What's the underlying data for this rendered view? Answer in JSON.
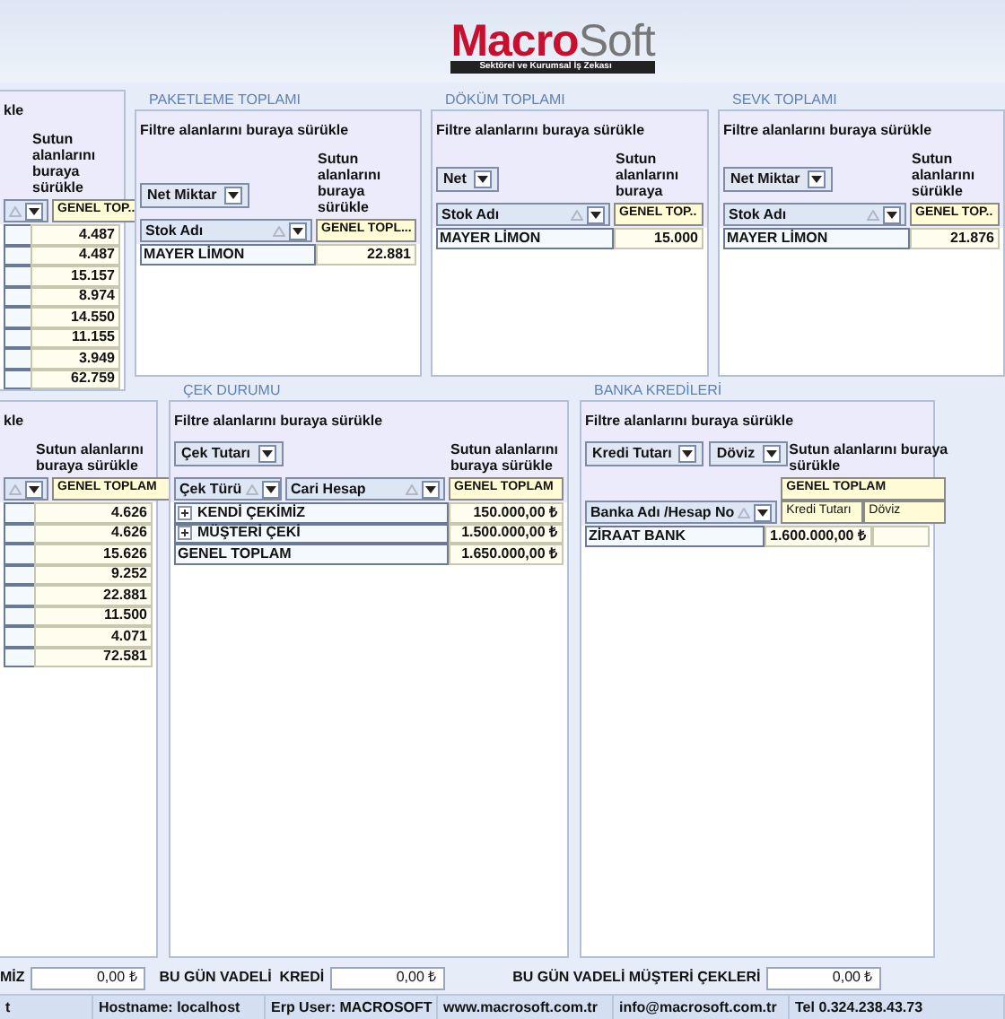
{
  "header": {
    "logo_primary": "Macro",
    "logo_secondary": "Soft",
    "tagline": "Sektörel ve Kurumsal İş Zekası"
  },
  "top_panels": [
    {
      "kind": "partial",
      "filter_hint": "kle",
      "column_hint": "Sutun alanlarını buraya sürükle",
      "column_header": "GENEL TOP..",
      "rows": [
        {
          "values": [
            "4.487"
          ]
        },
        {
          "values": [
            "4.487"
          ]
        },
        {
          "values": [
            "15.157"
          ]
        },
        {
          "values": [
            "8.974"
          ]
        },
        {
          "values": [
            "14.550"
          ]
        },
        {
          "values": [
            "11.155"
          ]
        },
        {
          "values": [
            "3.949"
          ]
        },
        {
          "values": [
            "62.759"
          ]
        }
      ]
    },
    {
      "kind": "full",
      "title": "PAKETLEME TOPLAMI",
      "filter_hint": "Filtre alanlarını buraya sürükle",
      "data_fields": [
        "Net Miktar"
      ],
      "column_hint": "Sutun alanlarını buraya sürükle",
      "row_headers": [
        "Stok Adı"
      ],
      "column_header": "GENEL TOPL...",
      "rows": [
        {
          "label": "MAYER LİMON",
          "values": [
            "22.881"
          ]
        }
      ]
    },
    {
      "kind": "full",
      "title": "DÖKÜM TOPLAMI",
      "filter_hint": "Filtre alanlarını buraya sürükle",
      "data_fields": [
        "Net"
      ],
      "column_hint": "Sutun alanlarını buraya",
      "row_headers": [
        "Stok Adı"
      ],
      "column_header": "GENEL TOP..",
      "rows": [
        {
          "label": "MAYER LİMON",
          "values": [
            "15.000"
          ]
        }
      ]
    },
    {
      "kind": "full",
      "title": "SEVK TOPLAMI",
      "filter_hint": "Filtre alanlarını buraya sürükle",
      "data_fields": [
        "Net Miktar"
      ],
      "column_hint": "Sutun alanlarını sürükle",
      "row_headers": [
        "Stok Adı"
      ],
      "column_header": "GENEL TOP..",
      "rows": [
        {
          "label": "MAYER LİMON",
          "values": [
            "21.876"
          ]
        }
      ]
    }
  ],
  "bottom_panels": [
    {
      "kind": "partial",
      "filter_hint": "kle",
      "column_hint": "Sutun alanlarını buraya sürükle",
      "column_header": "GENEL TOPLAM",
      "rows": [
        {
          "values": [
            "4.626"
          ]
        },
        {
          "values": [
            "4.626"
          ]
        },
        {
          "values": [
            "15.626"
          ]
        },
        {
          "values": [
            "9.252"
          ]
        },
        {
          "values": [
            "22.881"
          ]
        },
        {
          "values": [
            "11.500"
          ]
        },
        {
          "values": [
            "4.071"
          ]
        },
        {
          "values": [
            "72.581"
          ]
        }
      ]
    },
    {
      "kind": "full",
      "title": "ÇEK DURUMU",
      "filter_hint": "Filtre alanlarını buraya sürükle",
      "data_fields": [
        "Çek Tutarı"
      ],
      "column_hint": "Sutun alanlarını buraya sürükle",
      "row_headers": [
        "Çek Türü",
        "Cari Hesap"
      ],
      "column_header": "GENEL TOPLAM",
      "rows": [
        {
          "kind": "group",
          "expanded": false,
          "label": "KENDİ ÇEKİMİZ",
          "values": [
            "150.000,00 ₺"
          ]
        },
        {
          "kind": "group",
          "expanded": false,
          "label": "MÜŞTERİ ÇEKİ",
          "values": [
            "1.500.000,00 ₺"
          ]
        },
        {
          "kind": "total",
          "label": "GENEL TOPLAM",
          "values": [
            "1.650.000,00 ₺"
          ]
        }
      ]
    },
    {
      "kind": "full",
      "title": "BANKA KREDİLERİ",
      "filter_hint": "Filtre alanlarını buraya sürükle",
      "data_fields": [
        "Kredi Tutarı",
        "Döviz"
      ],
      "column_hint": "Sutun alanlarını buraya sürükle",
      "row_headers": [
        "Banka Adı /Hesap No"
      ],
      "column_header": "GENEL TOPLAM",
      "column_subheaders": [
        "Kredi Tutarı",
        "Döviz"
      ],
      "rows": [
        {
          "label": "ZİRAAT BANK",
          "values": [
            "1.600.000,00 ₺"
          ]
        }
      ]
    }
  ],
  "summary_fields": [
    {
      "label": "MİZ",
      "value": "0,00 ₺"
    },
    {
      "label": "BU GÜN VADELİ  KREDİ",
      "value": "0,00 ₺"
    },
    {
      "label": "BU GÜN VADELİ MÜŞTERİ ÇEKLERİ",
      "value": "0,00 ₺"
    }
  ],
  "status_bar": [
    "t",
    "Hostname: localhost",
    "Erp User: MACROSOFT",
    "www.macrosoft.com.tr",
    "info@macrosoft.com.tr",
    "Tel 0.324.238.43.73"
  ]
}
